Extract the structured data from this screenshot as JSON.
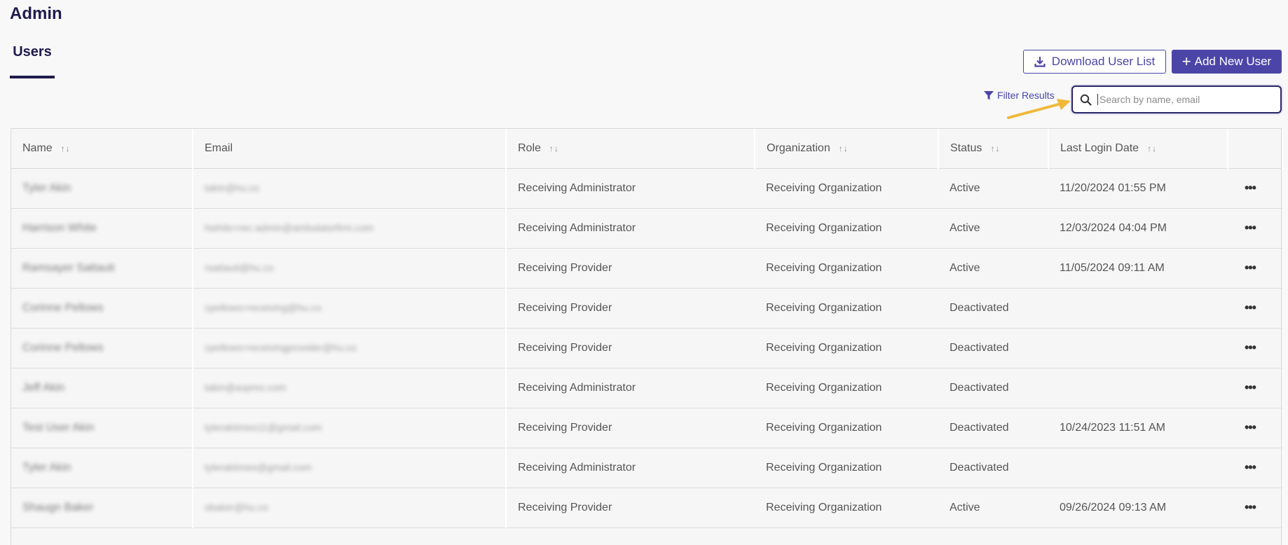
{
  "page": {
    "title": "Admin"
  },
  "tabs": [
    {
      "label": "Users",
      "active": true
    }
  ],
  "toolbar": {
    "download_label": "Download User List",
    "add_label": "Add New User",
    "filter_label": "Filter Results",
    "search_placeholder": "Search by name, email"
  },
  "colors": {
    "accent": "#4b45a8",
    "title": "#1f1b4d",
    "annotation_arrow": "#f0b93a"
  },
  "table": {
    "columns": [
      {
        "label": "Name",
        "sortable": true
      },
      {
        "label": "Email",
        "sortable": false
      },
      {
        "label": "Role",
        "sortable": true
      },
      {
        "label": "Organization",
        "sortable": true
      },
      {
        "label": "Status",
        "sortable": true
      },
      {
        "label": "Last Login Date",
        "sortable": true
      },
      {
        "label": "",
        "sortable": false
      }
    ],
    "sort_icon": "↑↓",
    "row_menu_icon": "•••",
    "rows": [
      {
        "name": "Tyler Akin",
        "email": "takin@hu.co",
        "role": "Receiving Administrator",
        "organization": "Receiving Organization",
        "status": "Active",
        "last_login": "11/20/2024 01:55 PM"
      },
      {
        "name": "Harrison White",
        "email": "hwhite+rec-admin@ambulatorfirm.com",
        "role": "Receiving Administrator",
        "organization": "Receiving Organization",
        "status": "Active",
        "last_login": "12/03/2024 04:04 PM"
      },
      {
        "name": "Ramsayer Sattauti",
        "email": "rsattauti@hu.co",
        "role": "Receiving Provider",
        "organization": "Receiving Organization",
        "status": "Active",
        "last_login": "11/05/2024 09:11 AM"
      },
      {
        "name": "Corinne Pellows",
        "email": "cpellows+receiving@hu.co",
        "role": "Receiving Provider",
        "organization": "Receiving Organization",
        "status": "Deactivated",
        "last_login": ""
      },
      {
        "name": "Corinne Pellows",
        "email": "cpellows+receivingprovider@hu.co",
        "role": "Receiving Provider",
        "organization": "Receiving Organization",
        "status": "Deactivated",
        "last_login": ""
      },
      {
        "name": "Jeff Akin",
        "email": "takin@aspmo.com",
        "role": "Receiving Administrator",
        "organization": "Receiving Organization",
        "status": "Deactivated",
        "last_login": ""
      },
      {
        "name": "Test User Akin",
        "email": "tyleraktimes11@gmail.com",
        "role": "Receiving Provider",
        "organization": "Receiving Organization",
        "status": "Deactivated",
        "last_login": "10/24/2023 11:51 AM"
      },
      {
        "name": "Tyler Akin",
        "email": "tyleraktimes@gmail.com",
        "role": "Receiving Administrator",
        "organization": "Receiving Organization",
        "status": "Deactivated",
        "last_login": ""
      },
      {
        "name": "Shaugn Baker",
        "email": "sbaker@hu.co",
        "role": "Receiving Provider",
        "organization": "Receiving Organization",
        "status": "Active",
        "last_login": "09/26/2024 09:13 AM"
      }
    ]
  }
}
